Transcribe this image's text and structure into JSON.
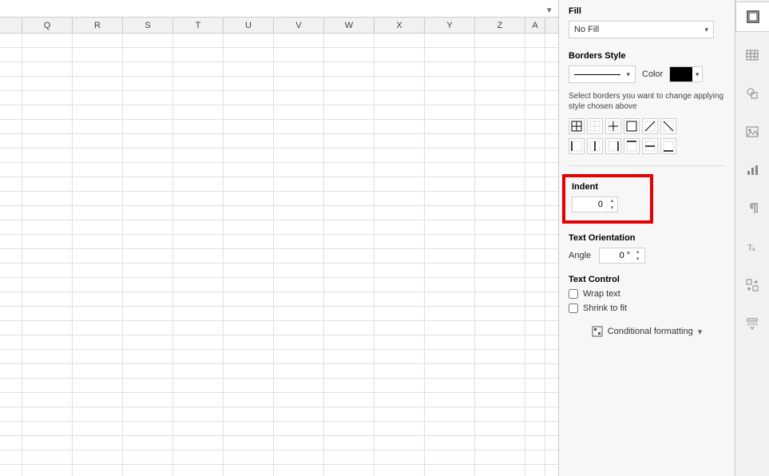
{
  "columns": [
    "Q",
    "R",
    "S",
    "T",
    "U",
    "V",
    "W",
    "X",
    "Y",
    "Z",
    "A"
  ],
  "rowCount": 31,
  "sidebar": {
    "fill": {
      "title": "Fill",
      "value": "No Fill"
    },
    "borders": {
      "title": "Borders Style",
      "color_label": "Color",
      "help": "Select borders you want to change applying style chosen above"
    },
    "indent": {
      "title": "Indent",
      "value": "0"
    },
    "orientation": {
      "title": "Text Orientation",
      "angle_label": "Angle",
      "angle_value": "0 °"
    },
    "textControl": {
      "title": "Text Control",
      "wrap": "Wrap text",
      "shrink": "Shrink to fit"
    },
    "condFormat": "Conditional formatting"
  }
}
